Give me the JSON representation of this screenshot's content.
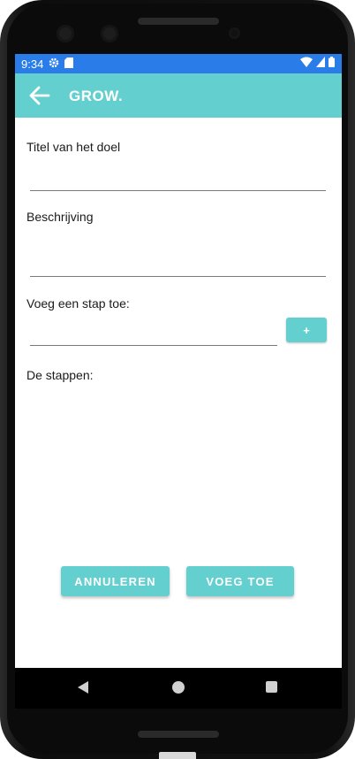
{
  "status_bar": {
    "time": "9:34",
    "icons": [
      "gear-icon",
      "sd-card-icon",
      "wifi-icon",
      "battery-icon"
    ]
  },
  "app_bar": {
    "title": "GROW.",
    "back_icon": "arrow-left-icon",
    "color": "#64cfcf"
  },
  "form": {
    "title_label": "Titel van het doel",
    "title_value": "",
    "description_label": "Beschrijving",
    "description_value": "",
    "step_label": "Voeg een stap toe:",
    "step_value": "",
    "add_step_label": "+",
    "steps_label": "De stappen:",
    "steps": []
  },
  "actions": {
    "cancel_label": "ANNULEREN",
    "add_label": "VOEG TOE"
  },
  "colors": {
    "accent": "#64cfcf",
    "status_bar": "#2a7de8"
  },
  "nav_bar": {
    "icons": [
      "back-triangle-icon",
      "home-circle-icon",
      "recents-square-icon"
    ]
  }
}
